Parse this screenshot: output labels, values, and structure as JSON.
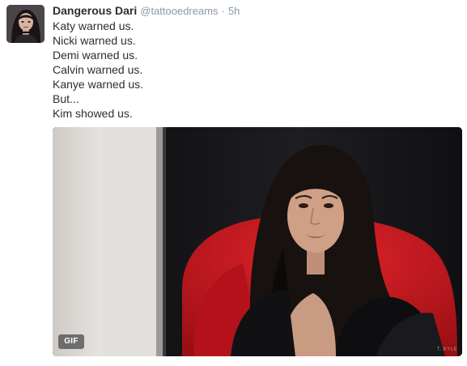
{
  "tweet": {
    "display_name": "Dangerous Dari",
    "handle": "@tattooedreams",
    "separator": "·",
    "timestamp": "5h",
    "lines": [
      "Katy warned us.",
      "Nicki warned us.",
      "Demi warned us.",
      "Calvin warned us.",
      "Kanye warned us.",
      "But...",
      "Kim showed us."
    ],
    "media": {
      "badge": "GIF",
      "watermark": "T. KYLE"
    }
  },
  "colors": {
    "name": "#292f33",
    "meta": "#8899a6",
    "chair_red": "#c4161c",
    "wall": "#dedad6",
    "curtain": "#16161a"
  }
}
